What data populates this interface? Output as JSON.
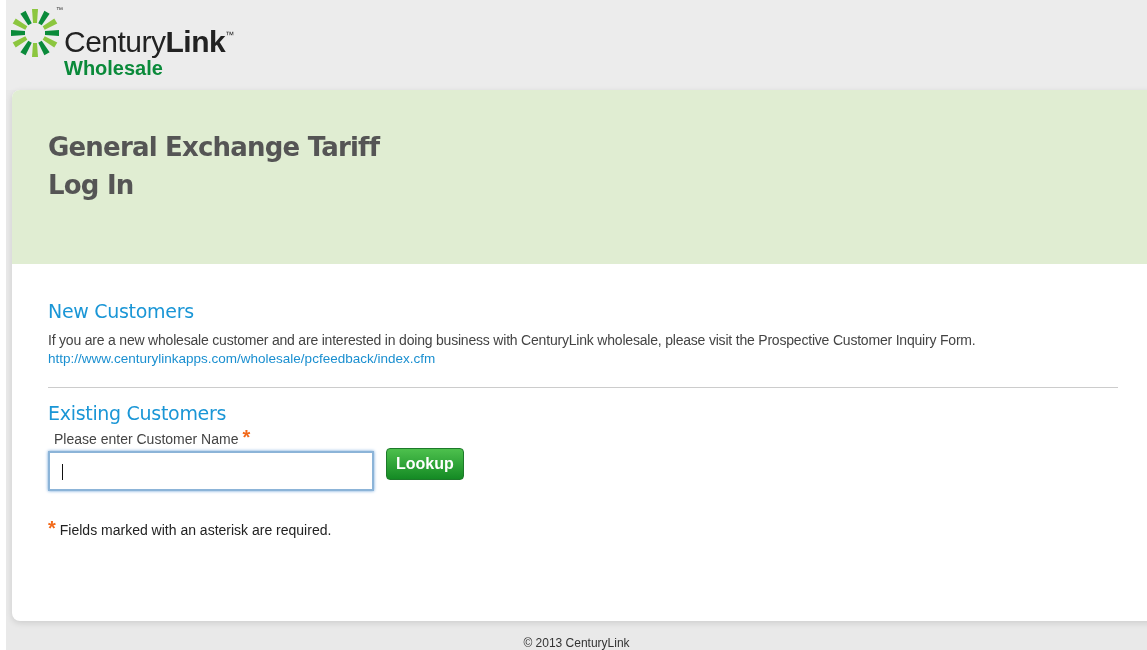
{
  "logo": {
    "icon_mark": "™",
    "wordmark": "Century**Link**$^{™}$",
    "subtitle": "Wholesale"
  },
  "header": {
    "title_lines": [
      "General Exchange Tariff",
      "Log In"
    ]
  },
  "new_customers": {
    "heading": "New Customers",
    "text": "If you are a new wholesale customer and are interested in doing business with CenturyLink wholesale, please visit the Prospective Customer Inquiry Form.",
    "link": "http://www.centurylinkapps.com/wholesale/pcfeedback/index.cfm"
  },
  "existing_customers": {
    "heading": "Existing Customers",
    "field_label": "Please enter Customer Name",
    "required_mark": "*",
    "field": {
      "focused": true
    },
    "button": "Lookup",
    "note_mark": "*",
    "note": "Fields marked with an asterisk are required."
  },
  "footer": "© 2013 CenturyLink"
}
